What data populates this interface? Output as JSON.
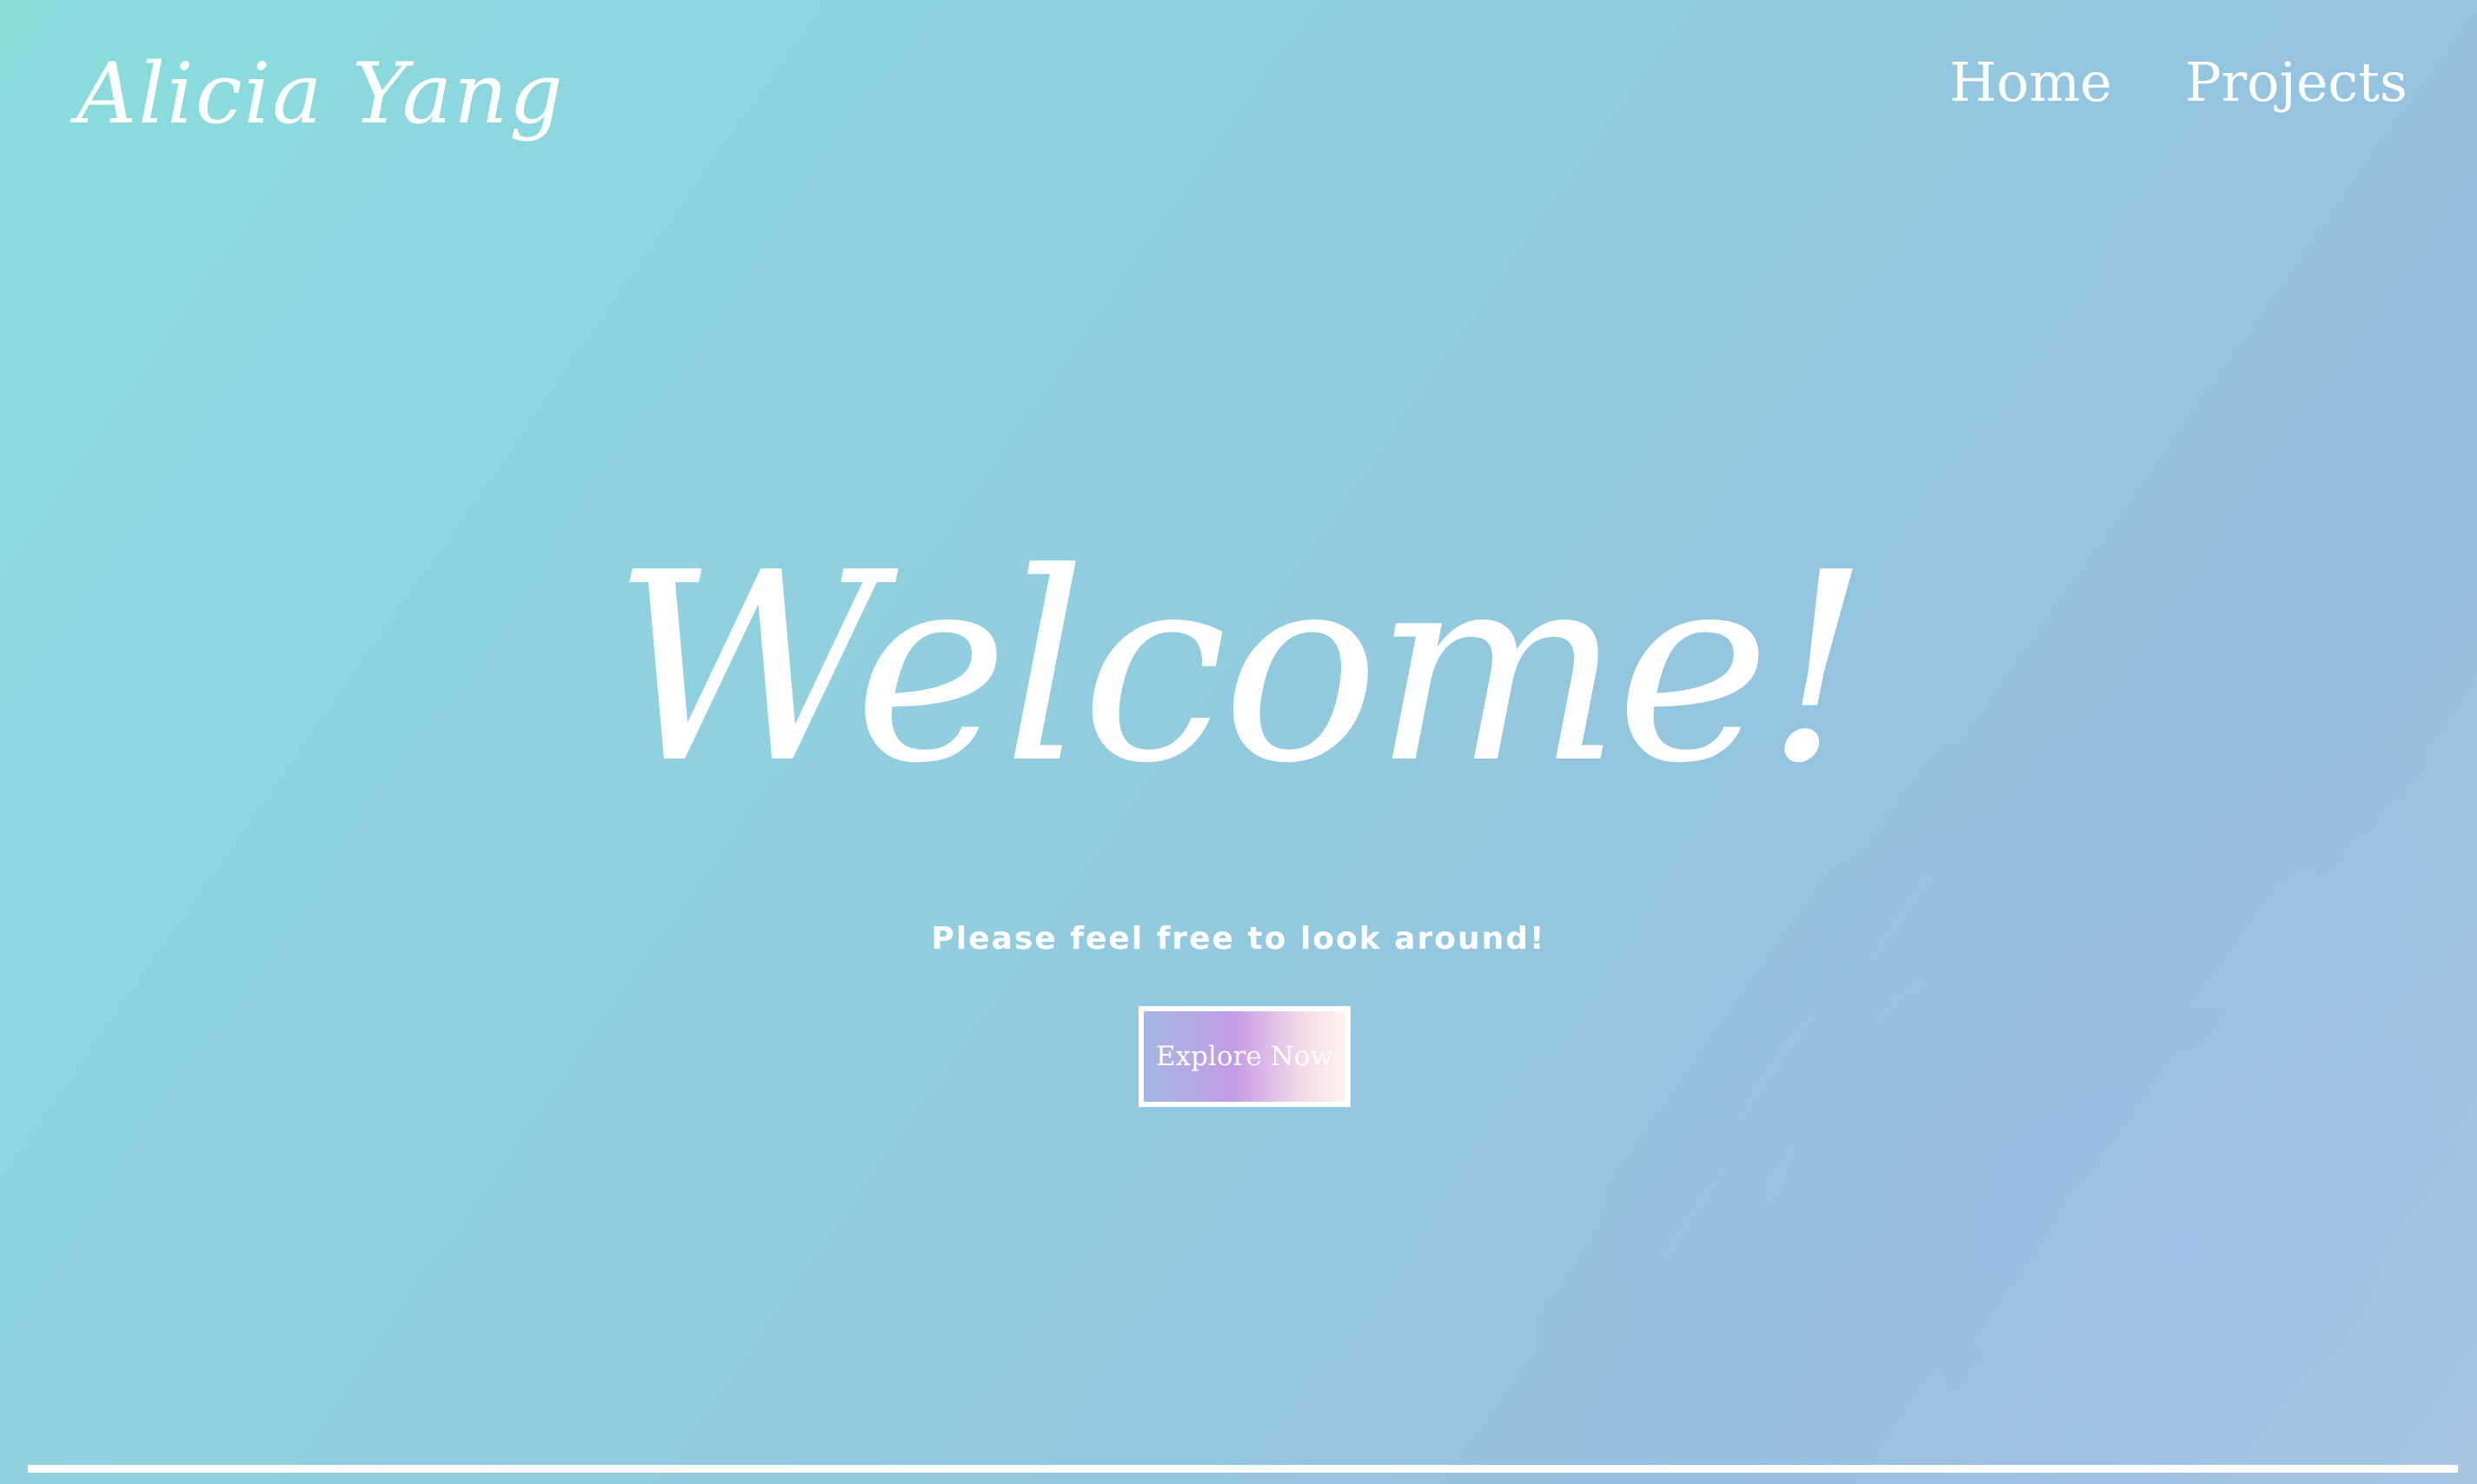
{
  "header": {
    "brand": "Alicia Yang",
    "nav": [
      {
        "label": "Home"
      },
      {
        "label": "Projects"
      }
    ]
  },
  "hero": {
    "title": "Welcome!",
    "subtitle": "Please feel free to look around!",
    "cta_label": "Explore Now"
  },
  "colors": {
    "background_start": "#89dedc",
    "background_end": "#a9c8e2",
    "text": "#ffffff",
    "button_gradient": [
      "#a3b8e3",
      "#c59be5",
      "#f6dde8",
      "#fff3f1"
    ]
  }
}
